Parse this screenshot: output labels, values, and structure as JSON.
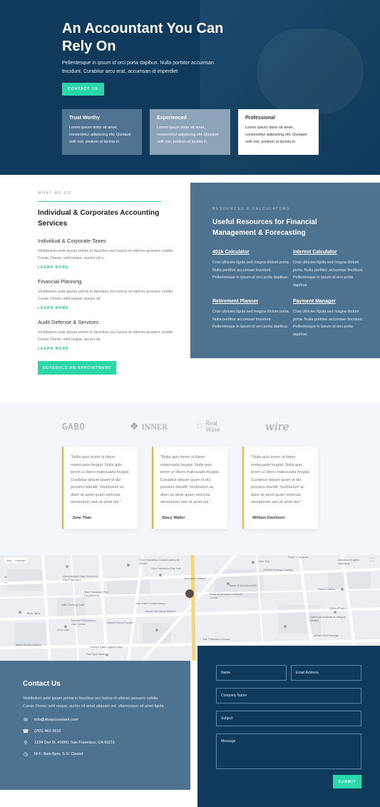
{
  "hero": {
    "title": "An Accountant You Can Rely On",
    "description": "Pellentesque in ipsum id orci porta dapibus. Nulla porttitor accumsan tincidunt. Curabitur arcu erat, accumsan id imperdiet",
    "cta_label": "CONTACT US",
    "cards": [
      {
        "title": "Trust Worthy",
        "text": "Lorem ipsum dolor sit amet, consectetur adipiscing elit. Quisque velit nisi, pretium ut lacinia in"
      },
      {
        "title": "Experienced",
        "text": "Lorem ipsum dolor sit amet, consectetur adipiscing elit. Quisque velit nisi, pretium ut lacinia in"
      },
      {
        "title": "Professional",
        "text": "Lorem ipsum dolor sit amet, consectetur adipiscing elit. Quisque velit nisi, pretium ut lacinia in"
      }
    ]
  },
  "services": {
    "eyebrow": "WHAT WE DO",
    "title": "Individual & Corporates Accounting Services",
    "items": [
      {
        "title": "Individual & Corporate Taxes",
        "text": "Vestibulum ante ipsum primis in faucibus orci luctus et ultrices posuere cubilia Curae; Donec velit neque, auctor sit a",
        "link": "LEARN MORE"
      },
      {
        "title": "Financial Planning",
        "text": "Vestibulum ante ipsum primis in faucibus orci luctus et ultrices posuere cubilia Curae; Donec velit neque, auctor sit",
        "link": "LEARN MORE"
      },
      {
        "title": "Audit Defense & Services",
        "text": "Vestibulum ante ipsum primis in faucibus orci luctus et ultrices posuere cubilia Curae; Donec velit neque, auctor sit",
        "link": "LEARN MORE"
      }
    ],
    "cta_label": "SCHEDULE AN APPOINTMENT"
  },
  "resources": {
    "eyebrow": "RESOURCES & CALCULATORS",
    "title": "Useful Resources for Financial Management & Forecasting",
    "items": [
      {
        "title": "401k Calculator",
        "text": "Cras ultricies ligula sed magna dictum porta. Nulla porttitor accumsan tincidunt. Pellentesque in ipsum id orci porta dapibus."
      },
      {
        "title": "Interest Calculator",
        "text": "Cras ultricies ligula sed magna dictum porta. Nulla porttitor accumsan tincidunt. Pellentesque in ipsum id orci porta dapibus."
      },
      {
        "title": "Retirement Planner",
        "text": "Cras ultricies ligula sed magna dictum porta. Nulla porttitor accumsan tincidunt. Pellentesque in ipsum id orci porta dapibus."
      },
      {
        "title": "Payment Manager",
        "text": "Cras ultricies ligula sed magna dictum porta. Nulla porttitor accumsan tincidunt. Pellentesque in ipsum id orci porta dapibus."
      }
    ]
  },
  "logos": [
    "GABO",
    "INNER",
    "Real Wave",
    "wire"
  ],
  "testimonials": [
    {
      "quote": "\"Nulla quis lorem ut libero malesuada feugiat. Nulla quis lorem ut libero malesuada feugiat. Curabitur aliquet quam id dui posuere blandit. Vestibulum ac diam sit amet quam vehicula elementum sed sit amet dui.\"",
      "name": "Jone Than"
    },
    {
      "quote": "\"Nulla quis lorem ut libero malesuada feugiat. Nulla quis lorem ut libero malesuada feugiat. Curabitur aliquet quam id dui posuere blandit. Vestibulum ac diam sit amet quam vehicula elementum sed sit amet dui.\"",
      "name": "Stacy Waller"
    },
    {
      "quote": "\"Nulla quis lorem ut libero malesuada feugiat. Nulla quis lorem ut libero malesuada feugiat. Curabitur aliquet quam id dui posuere blandit. Vestibulum ac diam sit amet quam vehicula elementum sed sit amet dui.\"",
      "name": "William Davidson"
    }
  ],
  "map": {
    "controls": [
      "Map",
      "Satellite"
    ],
    "labels": [
      "San Francisco Conservatory of Music",
      "International High School of San Francisco",
      "San Francisco Fire Department",
      "20th Century Cafe",
      "Kanbar Performing Arts Center",
      "Rich Table",
      "Zuni Café",
      "Nick's Super Market",
      "San Francisco City Hall",
      "Van Ness Station",
      "Bank of America ATM",
      "Bank of America Financial Center",
      "Metro Van Ness Station",
      "Star Park Conservatory",
      "Market Street Cycles",
      "Golden Gate Urgent Care",
      "Thai Spa Salon",
      "San Francisco Honda",
      "Uber HQ",
      "NOMA Parking Garage",
      "Steel + Lacquer",
      "Advance English Academy",
      "Peet's Coffee",
      "Urban Pharm",
      "California Institute of Integral Studies",
      "NOMA Self Storage"
    ]
  },
  "contact": {
    "title": "Contact Us",
    "description": "Vestibulum ante ipsum primis in faucibus orci luctus et ultrices posuere cubilia Curae; Donec velit neque, auctor sit amet aliquam vel, ullamcorper sit amet ligula.",
    "email": "info@diviaccountant.com",
    "phone": "(255) 462-3512",
    "address": "1234 Divi St. #1000, San Francisco, CA 93211",
    "hours": "M-F: 8am-5pm, S-S: Closed"
  },
  "form": {
    "name_placeholder": "Name",
    "email_placeholder": "Email Address",
    "company_placeholder": "Company Name",
    "subject_placeholder": "Subject",
    "message_placeholder": "Message",
    "submit_label": "SUBMIT"
  },
  "colors": {
    "accent": "#29d7a9",
    "navy": "#0f3a5c",
    "steel": "#4e7391",
    "gold": "#f0b429"
  }
}
